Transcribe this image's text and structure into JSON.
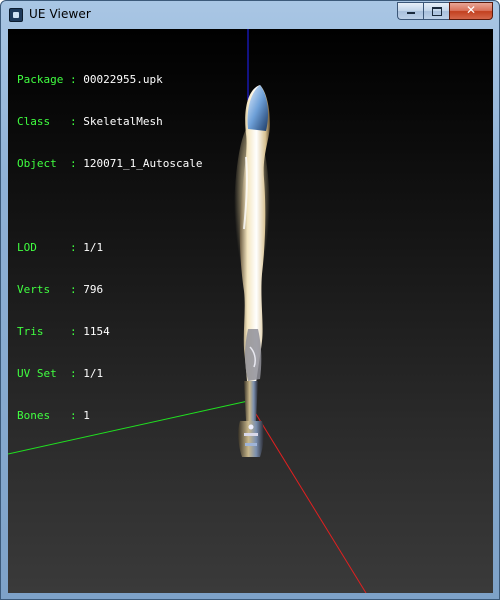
{
  "window": {
    "title": "UE Viewer",
    "close_glyph": "✕",
    "colors": {
      "label": "#40ff40",
      "value": "#ffffff",
      "axis_x": "#e02020",
      "axis_y": "#20e020",
      "axis_z": "#2020ff"
    }
  },
  "info": {
    "object_info": [
      {
        "label": "Package",
        "sep": " : ",
        "value": "00022955.upk"
      },
      {
        "label": "Class  ",
        "sep": " : ",
        "value": "SkeletalMesh"
      },
      {
        "label": "Object ",
        "sep": " : ",
        "value": "120071_1_Autoscale"
      }
    ],
    "mesh_stats": [
      {
        "label": "LOD    ",
        "sep": " : ",
        "value": "1/1"
      },
      {
        "label": "Verts  ",
        "sep": " : ",
        "value": "796"
      },
      {
        "label": "Tris   ",
        "sep": " : ",
        "value": "1154"
      },
      {
        "label": "UV Set ",
        "sep": " : ",
        "value": "1/1"
      },
      {
        "label": "Bones  ",
        "sep": " : ",
        "value": "1"
      }
    ]
  },
  "scene": {
    "icons": [
      "app-icon",
      "minimize-icon",
      "maximize-icon",
      "close-icon"
    ],
    "model": "sword-mesh"
  }
}
